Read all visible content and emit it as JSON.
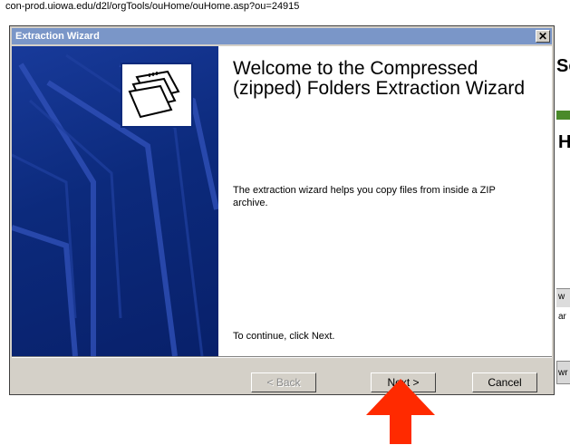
{
  "url": "con-prod.uiowa.edu/d2l/orgTools/ouHome/ouHome.asp?ou=24915",
  "dialog": {
    "title": "Extraction Wizard",
    "close_label": "✕",
    "heading": "Welcome to the Compressed (zipped) Folders Extraction Wizard",
    "description": "The extraction wizard helps you copy files from inside a ZIP archive.",
    "continue_text": "To continue, click Next."
  },
  "buttons": {
    "back": "< Back",
    "next": "Next >",
    "cancel": "Cancel"
  },
  "background_fragments": [
    "Sc",
    "H",
    "w",
    "ar",
    "wr"
  ],
  "icons": {
    "wizard": "compressed-folder-icon",
    "pointer": "red-arrow-icon"
  },
  "colors": {
    "title_bar": "#7a96c8",
    "side_panel": "#0c2a7c",
    "arrow": "#ff2a00"
  }
}
